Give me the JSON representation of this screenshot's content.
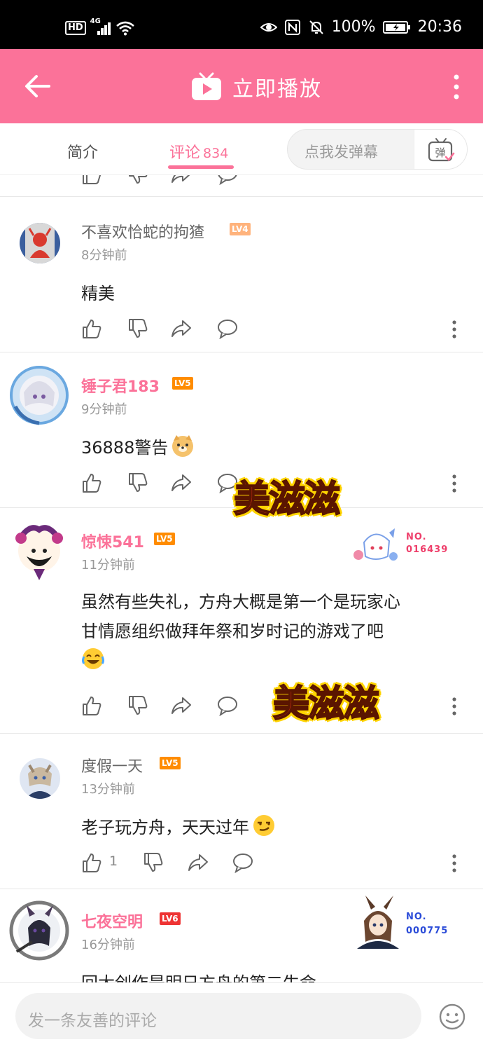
{
  "status_bar": {
    "hd": "HD",
    "network": "4G",
    "battery_percent": "100%",
    "time": "20:36"
  },
  "header": {
    "title": "立即播放"
  },
  "tabs": {
    "intro": "简介",
    "comments": "评论",
    "comment_count": "834",
    "danmaku_placeholder": "点我发弹幕",
    "danmaku_button": "弹"
  },
  "comments": [
    {
      "username": "不喜欢恰蛇的拘猹",
      "level": "LV4",
      "time": "8分钟前",
      "content": "精美",
      "name_highlight": false
    },
    {
      "username": "锤子君183",
      "level": "LV5",
      "time": "9分钟前",
      "content": "36888警告",
      "emoji": "doge-emoji",
      "name_highlight": true
    },
    {
      "username": "惊悚541",
      "level": "LV5",
      "time": "11分钟前",
      "content_line1": "虽然有些失礼，方舟大概是第一个是玩家心",
      "content_line2": "甘情愿组织做拜年祭和岁时记的游戏了吧",
      "emoji": "laugh-cry-emoji",
      "name_highlight": true,
      "badge_no": "NO.",
      "badge_num": "016439"
    },
    {
      "username": "度假一天",
      "level": "LV5",
      "time": "13分钟前",
      "content": "老子玩方舟，天天过年",
      "emoji": "smirk-emoji",
      "like_count": "1",
      "name_highlight": false
    },
    {
      "username": "七夜空明",
      "level": "LV6",
      "time": "16分钟前",
      "content_partial": "回大创作是明日方舟的第二生命",
      "name_highlight": true,
      "badge_no": "NO.",
      "badge_num": "000775"
    }
  ],
  "stickers": {
    "text": "美滋滋"
  },
  "bottom": {
    "input_placeholder": "发一条友善的评论"
  },
  "colors": {
    "accent": "#fb7299",
    "status_bar": "#000000"
  }
}
